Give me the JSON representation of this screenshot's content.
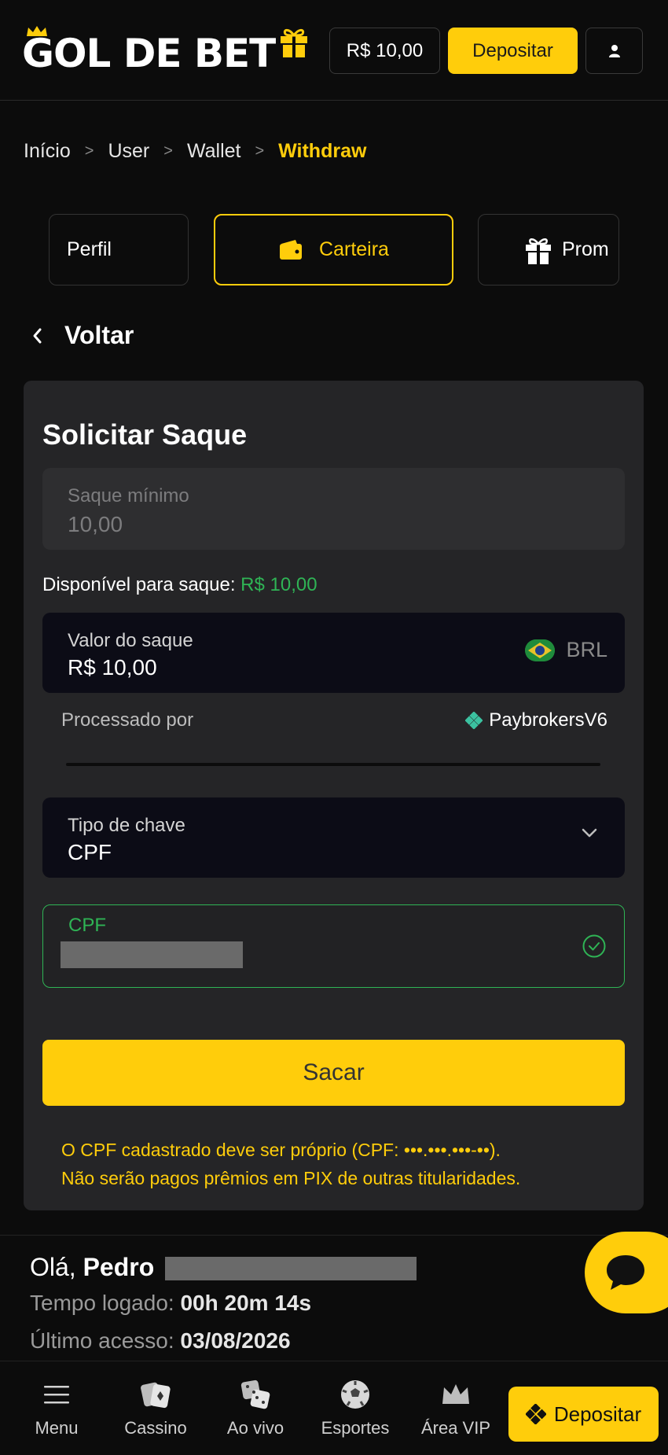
{
  "header": {
    "logo_text": "GOL DE BET",
    "balance": "R$ 10,00",
    "deposit_label": "Depositar"
  },
  "breadcrumb": {
    "items": [
      "Início",
      "User",
      "Wallet"
    ],
    "current": "Withdraw",
    "separator": ">"
  },
  "tabs": [
    {
      "label": "Perfil"
    },
    {
      "label": "Carteira",
      "active": true
    },
    {
      "label": "Prom"
    }
  ],
  "back_label": "Voltar",
  "withdraw": {
    "title": "Solicitar Saque",
    "min_label": "Saque mínimo",
    "min_value": "10,00",
    "available_label": "Disponível para saque:",
    "available_amount": "R$ 10,00",
    "value_label": "Valor do saque",
    "value": "R$ 10,00",
    "currency": "BRL",
    "processed_label": "Processado por",
    "provider": "PaybrokersV6",
    "key_type_label": "Tipo de chave",
    "key_type_value": "CPF",
    "cpf_label": "CPF",
    "submit_label": "Sacar",
    "notice_line1": "O CPF cadastrado deve ser próprio (CPF: •••.•••.•••-••).",
    "notice_line2": "Não serão pagos prêmios em PIX de outras titularidades."
  },
  "greeting": {
    "hello": "Olá,",
    "name": "Pedro",
    "time_label": "Tempo logado:",
    "time_value": "00h 20m 14s",
    "last_access_label": "Último acesso:",
    "last_access_value": "03/08/2026"
  },
  "bottom_nav": {
    "menu": "Menu",
    "cassino": "Cassino",
    "ao_vivo": "Ao vivo",
    "esportes": "Esportes",
    "vip": "Área VIP",
    "deposit": "Depositar"
  },
  "colors": {
    "accent": "#ffcd0b",
    "success": "#2fb455",
    "background": "#0c0c0c",
    "card": "#252527"
  }
}
